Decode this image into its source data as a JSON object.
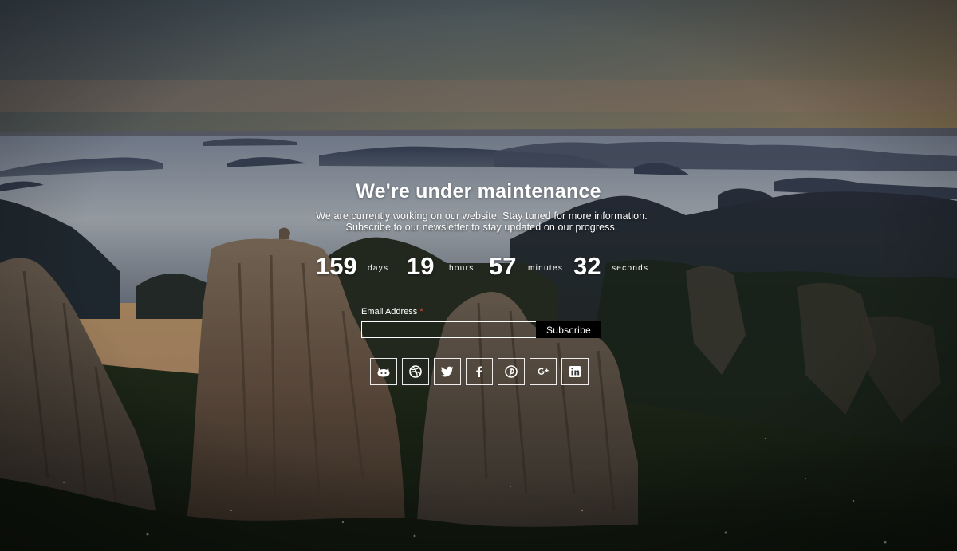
{
  "page": {
    "title": "We're under maintenance",
    "subtitle_line1": "We are currently working on our website. Stay tuned for more information.",
    "subtitle_line2": "Subscribe to our newsletter to stay updated on our progress."
  },
  "countdown": {
    "days_value": "159",
    "days_label": "days",
    "hours_value": "19",
    "hours_label": "hours",
    "minutes_value": "57",
    "minutes_label": "minutes",
    "seconds_value": "32",
    "seconds_label": "seconds"
  },
  "newsletter": {
    "label": "Email Address",
    "required_mark": "*",
    "value": "",
    "button_label": "Subscribe"
  },
  "social": [
    {
      "icon": "github-icon"
    },
    {
      "icon": "dribbble-icon"
    },
    {
      "icon": "twitter-icon"
    },
    {
      "icon": "facebook-icon"
    },
    {
      "icon": "pinterest-icon"
    },
    {
      "icon": "google-plus-icon"
    },
    {
      "icon": "linkedin-icon"
    }
  ],
  "colors": {
    "required": "#e0423a",
    "button_bg": "#000000",
    "text": "#ffffff"
  }
}
